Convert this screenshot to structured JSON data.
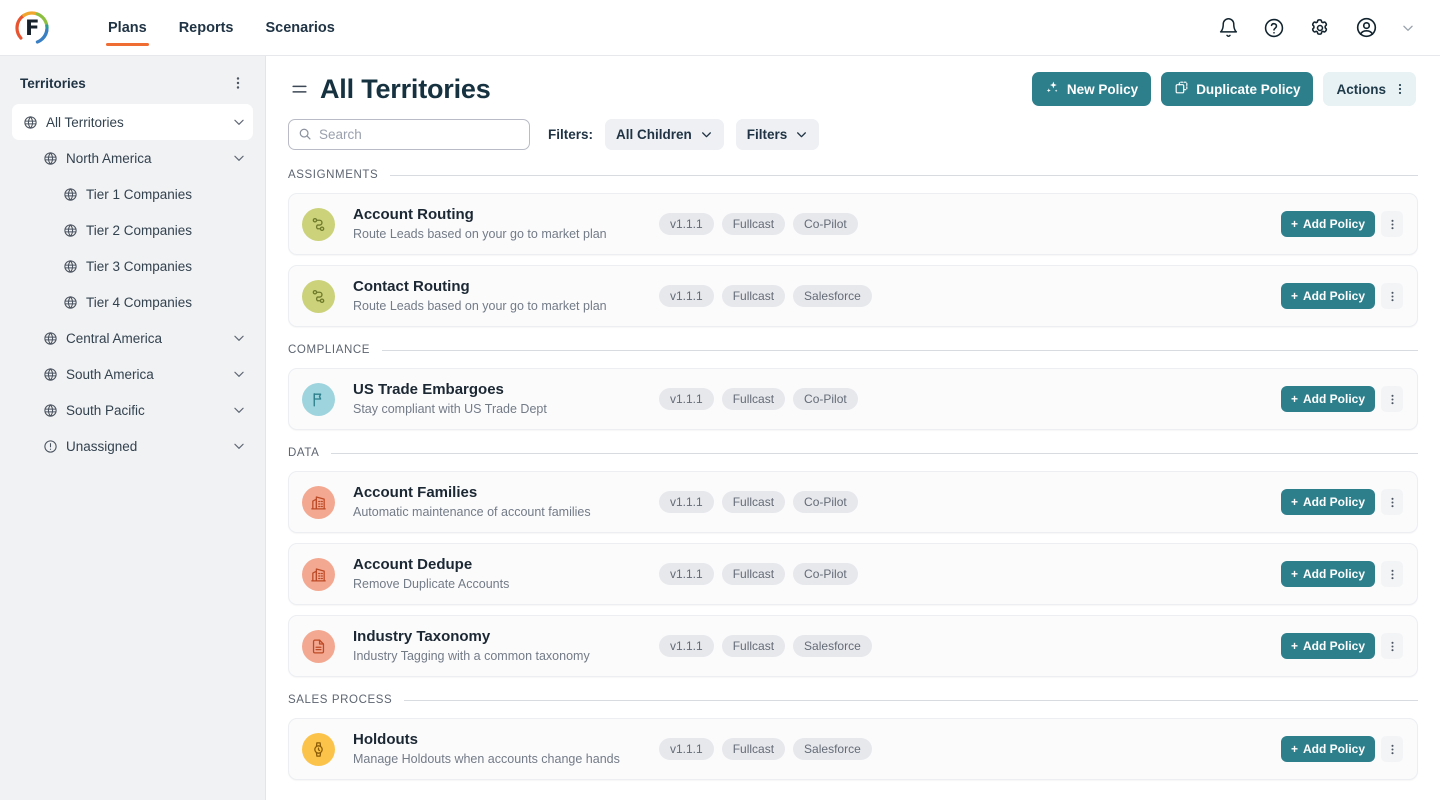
{
  "topnav": {
    "logo_letter": "F",
    "tabs": [
      {
        "label": "Plans",
        "active": true
      },
      {
        "label": "Reports",
        "active": false
      },
      {
        "label": "Scenarios",
        "active": false
      }
    ],
    "icons": [
      "bell-icon",
      "help-circle-icon",
      "gear-icon",
      "account-avatar-icon",
      "chevron-down-icon"
    ]
  },
  "sidebar": {
    "title": "Territories",
    "kebab": "more-vertical-icon",
    "items": [
      {
        "label": "All Territories",
        "depth": 0,
        "icon": "globe-icon",
        "chevron": true,
        "selected": true
      },
      {
        "label": "North America",
        "depth": 1,
        "icon": "globe-icon",
        "chevron": true,
        "selected": false
      },
      {
        "label": "Tier 1 Companies",
        "depth": 2,
        "icon": "globe-icon",
        "chevron": false,
        "selected": false
      },
      {
        "label": "Tier 2 Companies",
        "depth": 2,
        "icon": "globe-icon",
        "chevron": false,
        "selected": false
      },
      {
        "label": "Tier 3 Companies",
        "depth": 2,
        "icon": "globe-icon",
        "chevron": false,
        "selected": false
      },
      {
        "label": "Tier 4 Companies",
        "depth": 2,
        "icon": "globe-icon",
        "chevron": false,
        "selected": false
      },
      {
        "label": "Central America",
        "depth": 1,
        "icon": "globe-icon",
        "chevron": true,
        "selected": false
      },
      {
        "label": "South America",
        "depth": 1,
        "icon": "globe-icon",
        "chevron": true,
        "selected": false
      },
      {
        "label": "South Pacific",
        "depth": 1,
        "icon": "globe-icon",
        "chevron": true,
        "selected": false
      },
      {
        "label": "Unassigned",
        "depth": 1,
        "icon": "alert-circle-icon",
        "chevron": true,
        "selected": false
      }
    ]
  },
  "header": {
    "menu_icon": "hamburger-icon",
    "title": "All Territories",
    "new_policy_label": "New Policy",
    "duplicate_policy_label": "Duplicate Policy",
    "actions_label": "Actions"
  },
  "toolbar": {
    "search_placeholder": "Search",
    "search_value": "",
    "filters_label": "Filters:",
    "all_children_label": "All Children",
    "filters_button_label": "Filters"
  },
  "colors": {
    "accent_teal": "#2d7f8c",
    "accent_orange": "#ef6c33",
    "title_navy": "#16313f",
    "sidebar_bg": "#f1f2f4",
    "icon_green": "#cbd27a",
    "icon_blue": "#9ed4dd",
    "icon_salmon": "#f3a891",
    "icon_yellow": "#fbc34a"
  },
  "sections": [
    {
      "label": "ASSIGNMENTS",
      "cards": [
        {
          "title": "Account Routing",
          "subtitle": "Route Leads based on your go to market plan",
          "icon": "route-icon",
          "icon_bg": "#cbd27a",
          "icon_fg": "#6f7a2b",
          "tags": [
            "v1.1.1",
            "Fullcast",
            "Co-Pilot"
          ],
          "add_label": "Add Policy"
        },
        {
          "title": "Contact Routing",
          "subtitle": "Route Leads based on your go to market plan",
          "icon": "route-icon",
          "icon_bg": "#cbd27a",
          "icon_fg": "#6f7a2b",
          "tags": [
            "v1.1.1",
            "Fullcast",
            "Salesforce"
          ],
          "add_label": "Add Policy"
        }
      ]
    },
    {
      "label": "COMPLIANCE",
      "cards": [
        {
          "title": "US Trade Embargoes",
          "subtitle": "Stay compliant with US Trade Dept",
          "icon": "flag-icon",
          "icon_bg": "#9ed4dd",
          "icon_fg": "#2d7f8c",
          "tags": [
            "v1.1.1",
            "Fullcast",
            "Co-Pilot"
          ],
          "add_label": "Add Policy"
        }
      ]
    },
    {
      "label": "DATA",
      "cards": [
        {
          "title": "Account Families",
          "subtitle": "Automatic maintenance of account families",
          "icon": "building-icon",
          "icon_bg": "#f3a891",
          "icon_fg": "#bd4a26",
          "tags": [
            "v1.1.1",
            "Fullcast",
            "Co-Pilot"
          ],
          "add_label": "Add Policy"
        },
        {
          "title": "Account Dedupe",
          "subtitle": "Remove Duplicate Accounts",
          "icon": "building-icon",
          "icon_bg": "#f3a891",
          "icon_fg": "#bd4a26",
          "tags": [
            "v1.1.1",
            "Fullcast",
            "Co-Pilot"
          ],
          "add_label": "Add Policy"
        },
        {
          "title": "Industry Taxonomy",
          "subtitle": "Industry Tagging with a common taxonomy",
          "icon": "document-icon",
          "icon_bg": "#f3a891",
          "icon_fg": "#bd4a26",
          "tags": [
            "v1.1.1",
            "Fullcast",
            "Salesforce"
          ],
          "add_label": "Add Policy"
        }
      ]
    },
    {
      "label": "SALES PROCESS",
      "cards": [
        {
          "title": "Holdouts",
          "subtitle": "Manage Holdouts when accounts change hands",
          "icon": "watch-icon",
          "icon_bg": "#fbc34a",
          "icon_fg": "#8a5b06",
          "tags": [
            "v1.1.1",
            "Fullcast",
            "Salesforce"
          ],
          "add_label": "Add Policy"
        }
      ]
    }
  ]
}
